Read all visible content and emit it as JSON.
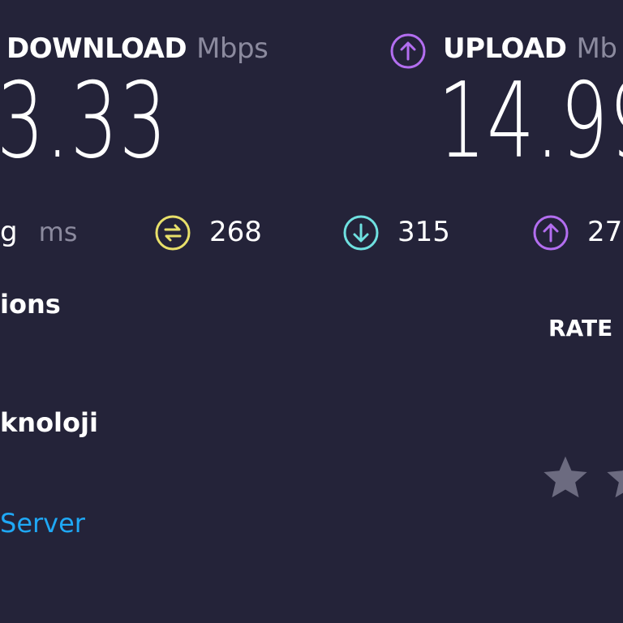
{
  "download": {
    "label": "DOWNLOAD",
    "unit": "Mbps",
    "value": "3.33"
  },
  "upload": {
    "label": "UPLOAD",
    "unit": "Mb",
    "value": "14.99",
    "icon": "upload-arrow-icon"
  },
  "ping": {
    "label": "g",
    "unit": "ms",
    "idle": {
      "value": "268",
      "icon": "ping-idle-icon",
      "color": "#e8e06a"
    },
    "download": {
      "value": "315",
      "icon": "download-arrow-icon",
      "color": "#6fe0e0"
    },
    "upload": {
      "value": "27",
      "icon": "upload-arrow-icon",
      "color": "#b36ef0"
    }
  },
  "connections": {
    "label": "ions"
  },
  "isp": {
    "name": "knoloji"
  },
  "server": {
    "link_label": "Server"
  },
  "rate": {
    "label": "RATE",
    "star_count_visible": 2
  },
  "colors": {
    "background": "#242339",
    "upload_accent": "#b36ef0",
    "download_accent": "#6fe0e0",
    "ping_accent": "#e8e06a",
    "link": "#1fa8f5",
    "muted": "#8b8a9e",
    "star": "#6c6b80"
  }
}
